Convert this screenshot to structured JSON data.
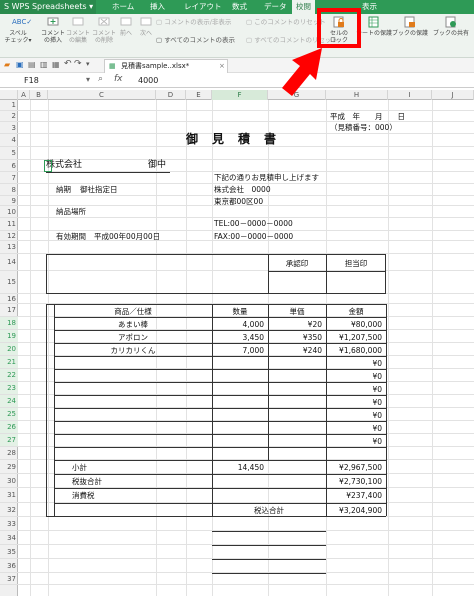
{
  "app": {
    "name": "WPS Spreadsheets",
    "accent": "#2e9a56"
  },
  "ribbon_tabs": [
    "ホーム",
    "挿入",
    "レイアウト",
    "数式",
    "データ",
    "校閲",
    "表示"
  ],
  "ribbon": {
    "spell_line1": "スペル",
    "spell_line2": "チェック▾",
    "insert_comment_1": "コメント",
    "insert_comment_2": "の挿入",
    "edit_comment_1": "コメント",
    "edit_comment_2": "の編集",
    "delete_comment_1": "コメント",
    "delete_comment_2": "の削除",
    "prev": "前へ",
    "next": "次へ",
    "show_hide_comment": "コメントの表示/非表示",
    "show_all_comments": "すべてのコメントの表示",
    "this_comment_reset": "このコメントのリセット",
    "all_comments_reset": "すべてのコメントのリセット",
    "lock_cell_1": "セルの",
    "lock_cell_2": "ロック",
    "protect_sheet": "シートの保護",
    "protect_book": "ブックの保護",
    "share_book": "ブックの共有"
  },
  "doc_tab": "見積書sample..xlsx*",
  "formula_bar": {
    "name_box": "F18",
    "fx": "fx",
    "value": "4000"
  },
  "columns": [
    "A",
    "B",
    "C",
    "D",
    "E",
    "F",
    "G",
    "H",
    "I",
    "J"
  ],
  "rows": [
    "1",
    "2",
    "3",
    "4",
    "5",
    "6",
    "7",
    "8",
    "9",
    "10",
    "11",
    "12",
    "13",
    "14",
    "15",
    "16",
    "17",
    "18",
    "19",
    "20",
    "21",
    "22",
    "23",
    "24",
    "25",
    "26",
    "27",
    "28",
    "29",
    "30",
    "31",
    "32",
    "33",
    "34",
    "35",
    "36",
    "37"
  ],
  "sheet": {
    "date_label": "平成　年　　月　　日",
    "quote_no": "（見積番号：000）",
    "title": "御　見　積　書",
    "company": "株式会社",
    "onchu": "御中",
    "greeting": "下記の通りお見積申し上げます",
    "delivery_label": "納期",
    "delivery_value": "御社指定日",
    "sender_company": "株式会社　0000",
    "sender_address": "東京都00区00",
    "delivery_place": "納品場所",
    "tel": "TEL:00－0000－0000",
    "fax": "FAX:00－0000－0000",
    "valid_label": "有効期間",
    "valid_value": "平成00年00月00日",
    "approval": "承認印",
    "person": "担当印",
    "headers": [
      "商品／仕様",
      "数量",
      "単価",
      "金額"
    ],
    "items": [
      {
        "name": "あまい棒",
        "qty": "4,000",
        "price": "¥20",
        "amount": "¥80,000"
      },
      {
        "name": "アポロン",
        "qty": "3,450",
        "price": "¥350",
        "amount": "¥1,207,500"
      },
      {
        "name": "カリカリくん",
        "qty": "7,000",
        "price": "¥240",
        "amount": "¥1,680,000"
      }
    ],
    "zero_amounts": [
      "¥0",
      "¥0",
      "¥0",
      "¥0",
      "¥0",
      "¥0",
      "¥0"
    ],
    "subtotal_label": "小計",
    "subtotal_qty": "14,450",
    "subtotal_amount": "¥2,967,500",
    "pretax_label": "税抜合計",
    "pretax_amount": "¥2,730,100",
    "tax_label": "消費税",
    "tax_amount": "¥237,400",
    "total_label": "税込合計",
    "total_amount": "¥3,204,900"
  }
}
